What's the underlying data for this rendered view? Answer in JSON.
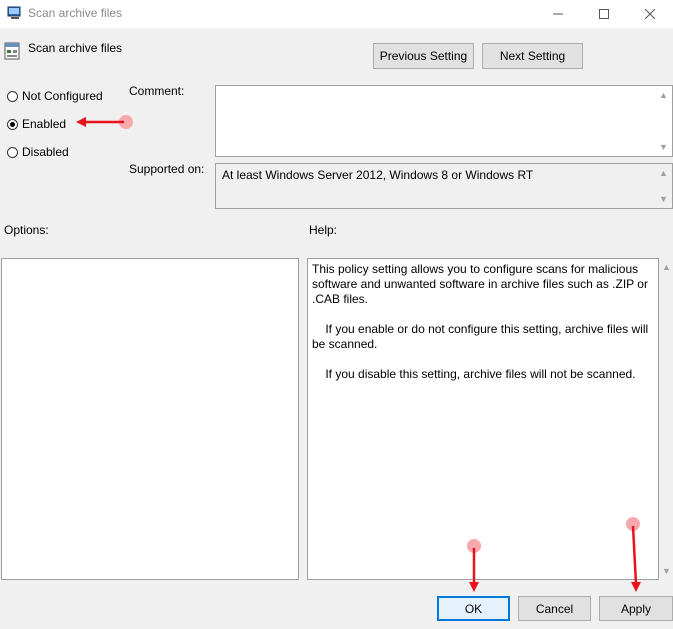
{
  "window": {
    "title": "Scan archive files",
    "policy_name": "Scan archive files"
  },
  "nav": {
    "previous_label": "Previous Setting",
    "next_label": "Next Setting"
  },
  "state": {
    "options": [
      {
        "label": "Not Configured",
        "checked": false
      },
      {
        "label": "Enabled",
        "checked": true
      },
      {
        "label": "Disabled",
        "checked": false
      }
    ]
  },
  "fields": {
    "comment_label": "Comment:",
    "comment_value": "",
    "supported_label": "Supported on:",
    "supported_value": "At least Windows Server 2012, Windows 8 or Windows RT"
  },
  "panels": {
    "options_label": "Options:",
    "help_label": "Help:",
    "help_text": "This policy setting allows you to configure scans for malicious software and unwanted software in archive files such as .ZIP or .CAB files.\n\n    If you enable or do not configure this setting, archive files will be scanned.\n\n    If you disable this setting, archive files will not be scanned."
  },
  "footer": {
    "ok_label": "OK",
    "cancel_label": "Cancel",
    "apply_label": "Apply"
  },
  "colors": {
    "annotation": "#e8141c",
    "focus_border": "#0078d7"
  }
}
